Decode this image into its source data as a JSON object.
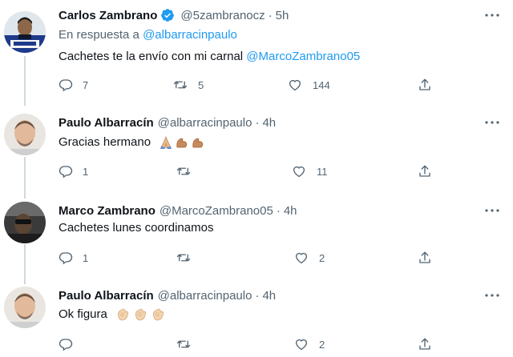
{
  "tweets": [
    {
      "name": "Carlos Zambrano",
      "verified": true,
      "handle": "@5zambranocz",
      "dot": "·",
      "time": "5h",
      "reply_prefix": "En respuesta a",
      "reply_to": "@albarracinpaulo",
      "text": "Cachetes te la envío con mi carnal",
      "text_mention": "@MarcoZambrano05",
      "emojis": [],
      "replies": "7",
      "retweets": "5",
      "likes": "144"
    },
    {
      "name": "Paulo Albarracín",
      "verified": false,
      "handle": "@albarracinpaulo",
      "dot": "·",
      "time": "4h",
      "text": "Gracias hermano",
      "emojis": [
        "folded-hands",
        "flexed-biceps",
        "flexed-biceps"
      ],
      "replies": "1",
      "retweets": "",
      "likes": "11"
    },
    {
      "name": "Marco Zambrano",
      "verified": false,
      "handle": "@MarcoZambrano05",
      "dot": "·",
      "time": "4h",
      "text": "Cachetes lunes coordinamos",
      "emojis": [],
      "replies": "1",
      "retweets": "",
      "likes": "2"
    },
    {
      "name": "Paulo Albarracín",
      "verified": false,
      "handle": "@albarracinpaulo",
      "dot": "·",
      "time": "4h",
      "text": "Ok figura",
      "emojis": [
        "clapping-hands",
        "clapping-hands",
        "clapping-hands"
      ],
      "replies": "",
      "retweets": "",
      "likes": "2"
    }
  ],
  "icons": {
    "reply": "reply-icon",
    "retweet": "retweet-icon",
    "like": "heart-icon",
    "share": "share-icon",
    "more": "more-icon",
    "verified": "verified-badge-icon"
  },
  "colors": {
    "link": "#1d9bf0",
    "secondary": "#536471",
    "thread_line": "#cfd9de",
    "verified": "#1d9bf0"
  }
}
